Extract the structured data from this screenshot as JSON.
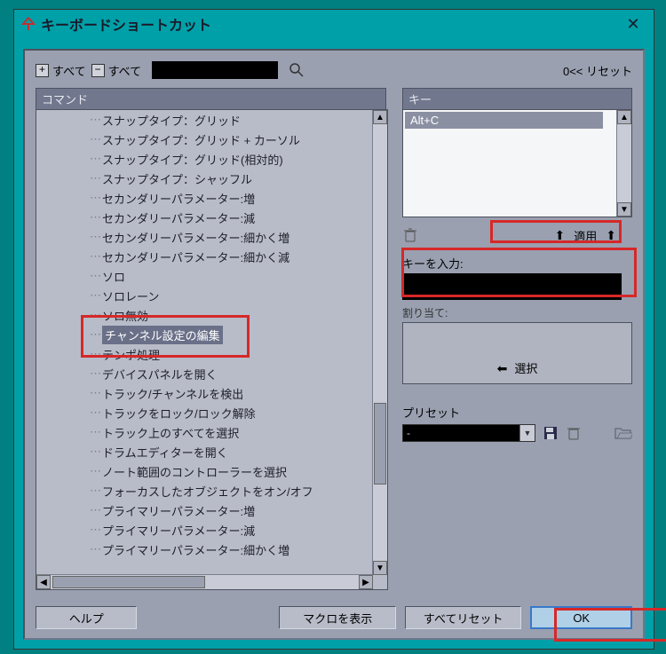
{
  "window": {
    "title": "キーボードショートカット"
  },
  "toolbar": {
    "expand_all": "すべて",
    "collapse_all": "すべて",
    "reset_top": "0<< リセット"
  },
  "left": {
    "header": "コマンド",
    "items": [
      "スナップタイプ：グリッド",
      "スナップタイプ：グリッド + カーソル",
      "スナップタイプ：グリッド(相対的)",
      "スナップタイプ：シャッフル",
      "セカンダリーパラメーター:増",
      "セカンダリーパラメーター:減",
      "セカンダリーパラメーター:細かく増",
      "セカンダリーパラメーター:細かく減",
      "ソロ",
      "ソロレーン",
      "ソロ無効",
      "チャンネル設定の編集",
      "テンポ処理",
      "デバイスパネルを開く",
      "トラック/チャンネルを検出",
      "トラックをロック/ロック解除",
      "トラック上のすべてを選択",
      "ドラムエディターを開く",
      "ノート範囲のコントローラーを選択",
      "フォーカスしたオブジェクトをオン/オフ",
      "プライマリーパラメーター:増",
      "プライマリーパラメーター:減",
      "プライマリーパラメーター:細かく増"
    ],
    "selected_index": 11
  },
  "right": {
    "keys_header": "キー",
    "assigned_key": "Alt+C",
    "apply_label": "適用",
    "input_label": "キーを入力:",
    "assign_label": "割り当て:",
    "select_label": "選択",
    "preset_label": "プリセット",
    "preset_value": "-"
  },
  "buttons": {
    "help": "ヘルプ",
    "macro": "マクロを表示",
    "reset_all": "すべてリセット",
    "ok": "OK"
  }
}
